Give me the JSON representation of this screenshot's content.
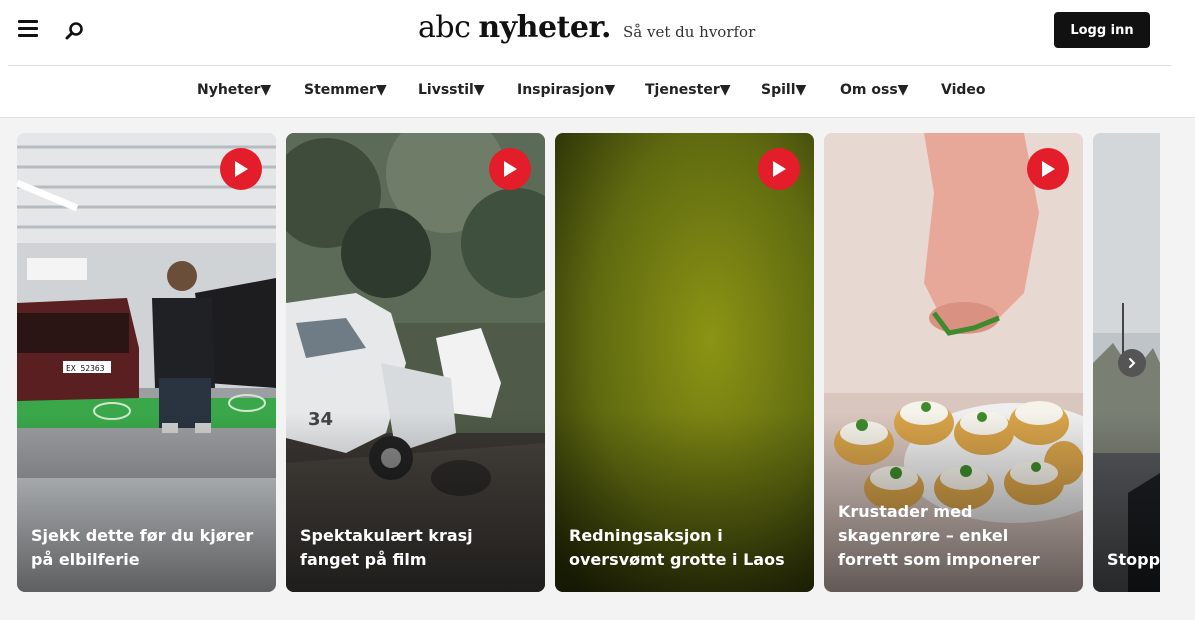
{
  "header": {
    "logo_abc": "abc",
    "logo_nyheter": "nyheter.",
    "tagline": "Så vet du hvorfor",
    "login_label": "Logg inn"
  },
  "nav": {
    "items": [
      {
        "label": "Nyheter▼"
      },
      {
        "label": "Stemmer▼"
      },
      {
        "label": "Livsstil▼"
      },
      {
        "label": "Inspirasjon▼"
      },
      {
        "label": "Tjenester▼"
      },
      {
        "label": "Spill▼"
      },
      {
        "label": "Om oss▼"
      },
      {
        "label": "Video"
      }
    ]
  },
  "videos": [
    {
      "title": "Sjekk dette før du kjører på elbilferie",
      "plate": "EX 52363",
      "icon": "play-icon"
    },
    {
      "title": "Spektakulært krasj fanget på film",
      "car_number": "34",
      "icon": "play-icon"
    },
    {
      "title": "Redningsaksjon i oversvømt grotte i Laos",
      "icon": "play-icon"
    },
    {
      "title": "Krustader med skagenrøre – enkel forrett som imponerer",
      "icon": "play-icon"
    },
    {
      "title": "Stopp"
    }
  ],
  "colors": {
    "accent_red": "#e41d2b",
    "header_bg": "#ffffff",
    "page_bg": "#f3f3f3",
    "button_dark": "#111111"
  }
}
